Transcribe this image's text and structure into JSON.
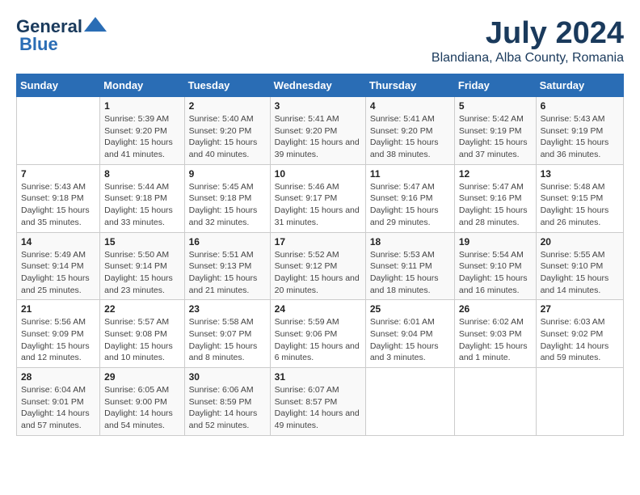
{
  "header": {
    "logo_line1": "General",
    "logo_line2": "Blue",
    "title": "July 2024",
    "subtitle": "Blandiana, Alba County, Romania"
  },
  "days_of_week": [
    "Sunday",
    "Monday",
    "Tuesday",
    "Wednesday",
    "Thursday",
    "Friday",
    "Saturday"
  ],
  "weeks": [
    [
      {
        "day": "",
        "sunrise": "",
        "sunset": "",
        "daylight": ""
      },
      {
        "day": "1",
        "sunrise": "Sunrise: 5:39 AM",
        "sunset": "Sunset: 9:20 PM",
        "daylight": "Daylight: 15 hours and 41 minutes."
      },
      {
        "day": "2",
        "sunrise": "Sunrise: 5:40 AM",
        "sunset": "Sunset: 9:20 PM",
        "daylight": "Daylight: 15 hours and 40 minutes."
      },
      {
        "day": "3",
        "sunrise": "Sunrise: 5:41 AM",
        "sunset": "Sunset: 9:20 PM",
        "daylight": "Daylight: 15 hours and 39 minutes."
      },
      {
        "day": "4",
        "sunrise": "Sunrise: 5:41 AM",
        "sunset": "Sunset: 9:20 PM",
        "daylight": "Daylight: 15 hours and 38 minutes."
      },
      {
        "day": "5",
        "sunrise": "Sunrise: 5:42 AM",
        "sunset": "Sunset: 9:19 PM",
        "daylight": "Daylight: 15 hours and 37 minutes."
      },
      {
        "day": "6",
        "sunrise": "Sunrise: 5:43 AM",
        "sunset": "Sunset: 9:19 PM",
        "daylight": "Daylight: 15 hours and 36 minutes."
      }
    ],
    [
      {
        "day": "7",
        "sunrise": "Sunrise: 5:43 AM",
        "sunset": "Sunset: 9:18 PM",
        "daylight": "Daylight: 15 hours and 35 minutes."
      },
      {
        "day": "8",
        "sunrise": "Sunrise: 5:44 AM",
        "sunset": "Sunset: 9:18 PM",
        "daylight": "Daylight: 15 hours and 33 minutes."
      },
      {
        "day": "9",
        "sunrise": "Sunrise: 5:45 AM",
        "sunset": "Sunset: 9:18 PM",
        "daylight": "Daylight: 15 hours and 32 minutes."
      },
      {
        "day": "10",
        "sunrise": "Sunrise: 5:46 AM",
        "sunset": "Sunset: 9:17 PM",
        "daylight": "Daylight: 15 hours and 31 minutes."
      },
      {
        "day": "11",
        "sunrise": "Sunrise: 5:47 AM",
        "sunset": "Sunset: 9:16 PM",
        "daylight": "Daylight: 15 hours and 29 minutes."
      },
      {
        "day": "12",
        "sunrise": "Sunrise: 5:47 AM",
        "sunset": "Sunset: 9:16 PM",
        "daylight": "Daylight: 15 hours and 28 minutes."
      },
      {
        "day": "13",
        "sunrise": "Sunrise: 5:48 AM",
        "sunset": "Sunset: 9:15 PM",
        "daylight": "Daylight: 15 hours and 26 minutes."
      }
    ],
    [
      {
        "day": "14",
        "sunrise": "Sunrise: 5:49 AM",
        "sunset": "Sunset: 9:14 PM",
        "daylight": "Daylight: 15 hours and 25 minutes."
      },
      {
        "day": "15",
        "sunrise": "Sunrise: 5:50 AM",
        "sunset": "Sunset: 9:14 PM",
        "daylight": "Daylight: 15 hours and 23 minutes."
      },
      {
        "day": "16",
        "sunrise": "Sunrise: 5:51 AM",
        "sunset": "Sunset: 9:13 PM",
        "daylight": "Daylight: 15 hours and 21 minutes."
      },
      {
        "day": "17",
        "sunrise": "Sunrise: 5:52 AM",
        "sunset": "Sunset: 9:12 PM",
        "daylight": "Daylight: 15 hours and 20 minutes."
      },
      {
        "day": "18",
        "sunrise": "Sunrise: 5:53 AM",
        "sunset": "Sunset: 9:11 PM",
        "daylight": "Daylight: 15 hours and 18 minutes."
      },
      {
        "day": "19",
        "sunrise": "Sunrise: 5:54 AM",
        "sunset": "Sunset: 9:10 PM",
        "daylight": "Daylight: 15 hours and 16 minutes."
      },
      {
        "day": "20",
        "sunrise": "Sunrise: 5:55 AM",
        "sunset": "Sunset: 9:10 PM",
        "daylight": "Daylight: 15 hours and 14 minutes."
      }
    ],
    [
      {
        "day": "21",
        "sunrise": "Sunrise: 5:56 AM",
        "sunset": "Sunset: 9:09 PM",
        "daylight": "Daylight: 15 hours and 12 minutes."
      },
      {
        "day": "22",
        "sunrise": "Sunrise: 5:57 AM",
        "sunset": "Sunset: 9:08 PM",
        "daylight": "Daylight: 15 hours and 10 minutes."
      },
      {
        "day": "23",
        "sunrise": "Sunrise: 5:58 AM",
        "sunset": "Sunset: 9:07 PM",
        "daylight": "Daylight: 15 hours and 8 minutes."
      },
      {
        "day": "24",
        "sunrise": "Sunrise: 5:59 AM",
        "sunset": "Sunset: 9:06 PM",
        "daylight": "Daylight: 15 hours and 6 minutes."
      },
      {
        "day": "25",
        "sunrise": "Sunrise: 6:01 AM",
        "sunset": "Sunset: 9:04 PM",
        "daylight": "Daylight: 15 hours and 3 minutes."
      },
      {
        "day": "26",
        "sunrise": "Sunrise: 6:02 AM",
        "sunset": "Sunset: 9:03 PM",
        "daylight": "Daylight: 15 hours and 1 minute."
      },
      {
        "day": "27",
        "sunrise": "Sunrise: 6:03 AM",
        "sunset": "Sunset: 9:02 PM",
        "daylight": "Daylight: 14 hours and 59 minutes."
      }
    ],
    [
      {
        "day": "28",
        "sunrise": "Sunrise: 6:04 AM",
        "sunset": "Sunset: 9:01 PM",
        "daylight": "Daylight: 14 hours and 57 minutes."
      },
      {
        "day": "29",
        "sunrise": "Sunrise: 6:05 AM",
        "sunset": "Sunset: 9:00 PM",
        "daylight": "Daylight: 14 hours and 54 minutes."
      },
      {
        "day": "30",
        "sunrise": "Sunrise: 6:06 AM",
        "sunset": "Sunset: 8:59 PM",
        "daylight": "Daylight: 14 hours and 52 minutes."
      },
      {
        "day": "31",
        "sunrise": "Sunrise: 6:07 AM",
        "sunset": "Sunset: 8:57 PM",
        "daylight": "Daylight: 14 hours and 49 minutes."
      },
      {
        "day": "",
        "sunrise": "",
        "sunset": "",
        "daylight": ""
      },
      {
        "day": "",
        "sunrise": "",
        "sunset": "",
        "daylight": ""
      },
      {
        "day": "",
        "sunrise": "",
        "sunset": "",
        "daylight": ""
      }
    ]
  ]
}
